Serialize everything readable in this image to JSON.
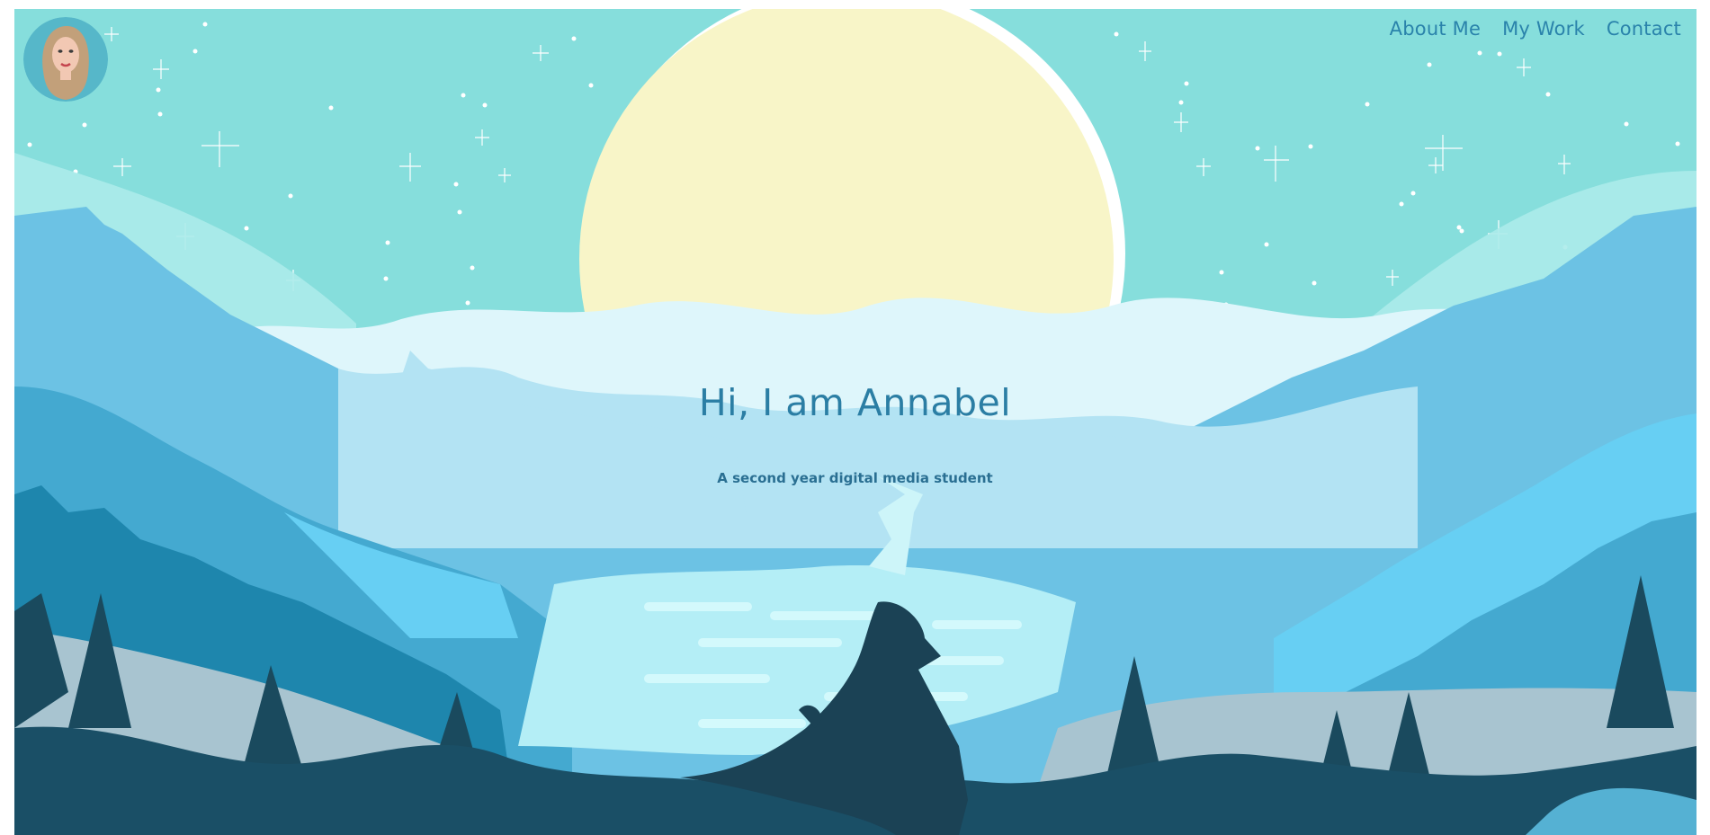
{
  "nav": {
    "items": [
      {
        "label": "About Me"
      },
      {
        "label": "My Work"
      },
      {
        "label": "Contact"
      }
    ]
  },
  "hero": {
    "title": "Hi, I am Annabel",
    "subtitle": "A second year digital media student"
  },
  "colors": {
    "sky": "#86dedc",
    "moon": "#f8f5c8",
    "nav_text": "#2a83ab",
    "title_text": "#2b7ea4",
    "dark_silhouette": "#1b4255"
  },
  "icons": {
    "avatar": "profile-portrait-icon"
  }
}
